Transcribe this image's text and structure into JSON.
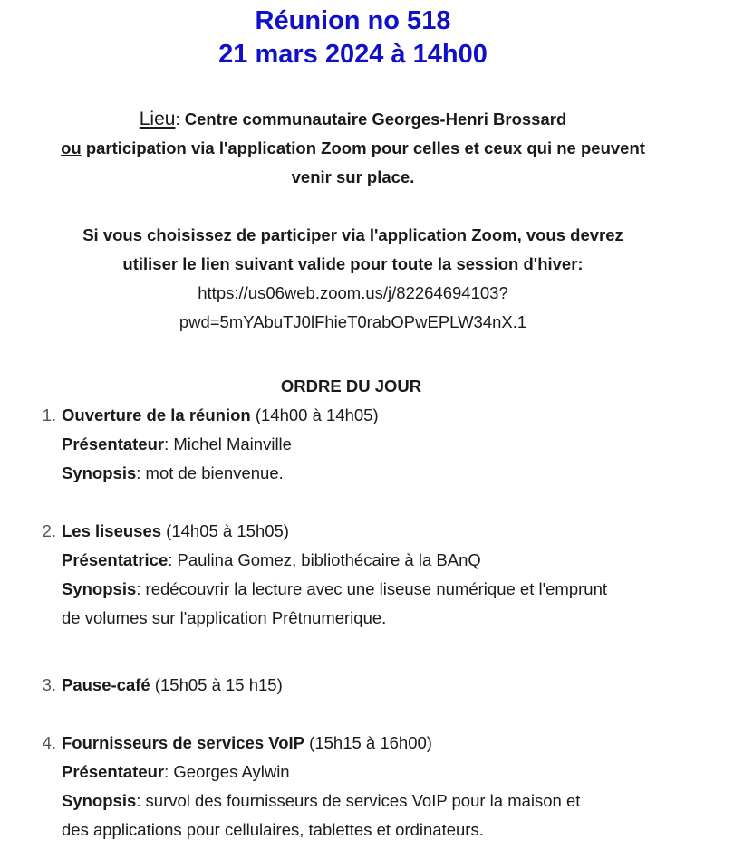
{
  "header": {
    "title_line1": "Réunion no 518",
    "title_line2": "21 mars 2024 à 14h00"
  },
  "location": {
    "label": "Lieu",
    "sep": ": ",
    "place": "Centre communautaire Georges-Henri Brossard",
    "or_word": "ou",
    "zoom_line1_rest": " participation via l'application Zoom pour celles et ceux qui ne peuvent",
    "zoom_line2": "venir sur place."
  },
  "zoom_info": {
    "line1": "Si vous choisissez de participer via l'application Zoom,  vous devrez",
    "line2": "utiliser le lien suivant valide pour toute la session d'hiver:",
    "link_line1": "https://us06web.zoom.us/j/82264694103?",
    "link_line2": "pwd=5mYAbuTJ0lFhieT0rabOPwEPLW34nX.1"
  },
  "agenda": {
    "title": "ORDRE DU JOUR",
    "items": [
      {
        "num": "1.",
        "name": "Ouverture de la réunion",
        "time": " (14h00 à 14h05)",
        "presenter_label": "Présentateur",
        "presenter": ": Michel Mainville",
        "synopsis_label": "Synopsis",
        "synopsis_line1": ": mot de bienvenue."
      },
      {
        "num": "2.",
        "name": "Les liseuses",
        "time": " (14h05 à 15h05)",
        "presenter_label": "Présentatrice",
        "presenter": ": Paulina Gomez, bibliothécaire à la BAnQ",
        "synopsis_label": "Synopsis",
        "synopsis_line1": ": redécouvrir la lecture avec une liseuse numérique et l'emprunt",
        "synopsis_line2": "de volumes sur l'application Prêtnumerique."
      },
      {
        "num": "3.",
        "name": "Pause-café",
        "time": " (15h05 à 15 h15)"
      },
      {
        "num": "4.",
        "name": "Fournisseurs de services VoIP",
        "time": " (15h15 à 16h00)",
        "presenter_label": "Présentateur",
        "presenter": ": Georges Aylwin",
        "synopsis_label": "Synopsis",
        "synopsis_line1": ": survol des fournisseurs de services VoIP pour la maison et",
        "synopsis_line2": "des applications pour cellulaires, tablettes et ordinateurs."
      }
    ]
  }
}
